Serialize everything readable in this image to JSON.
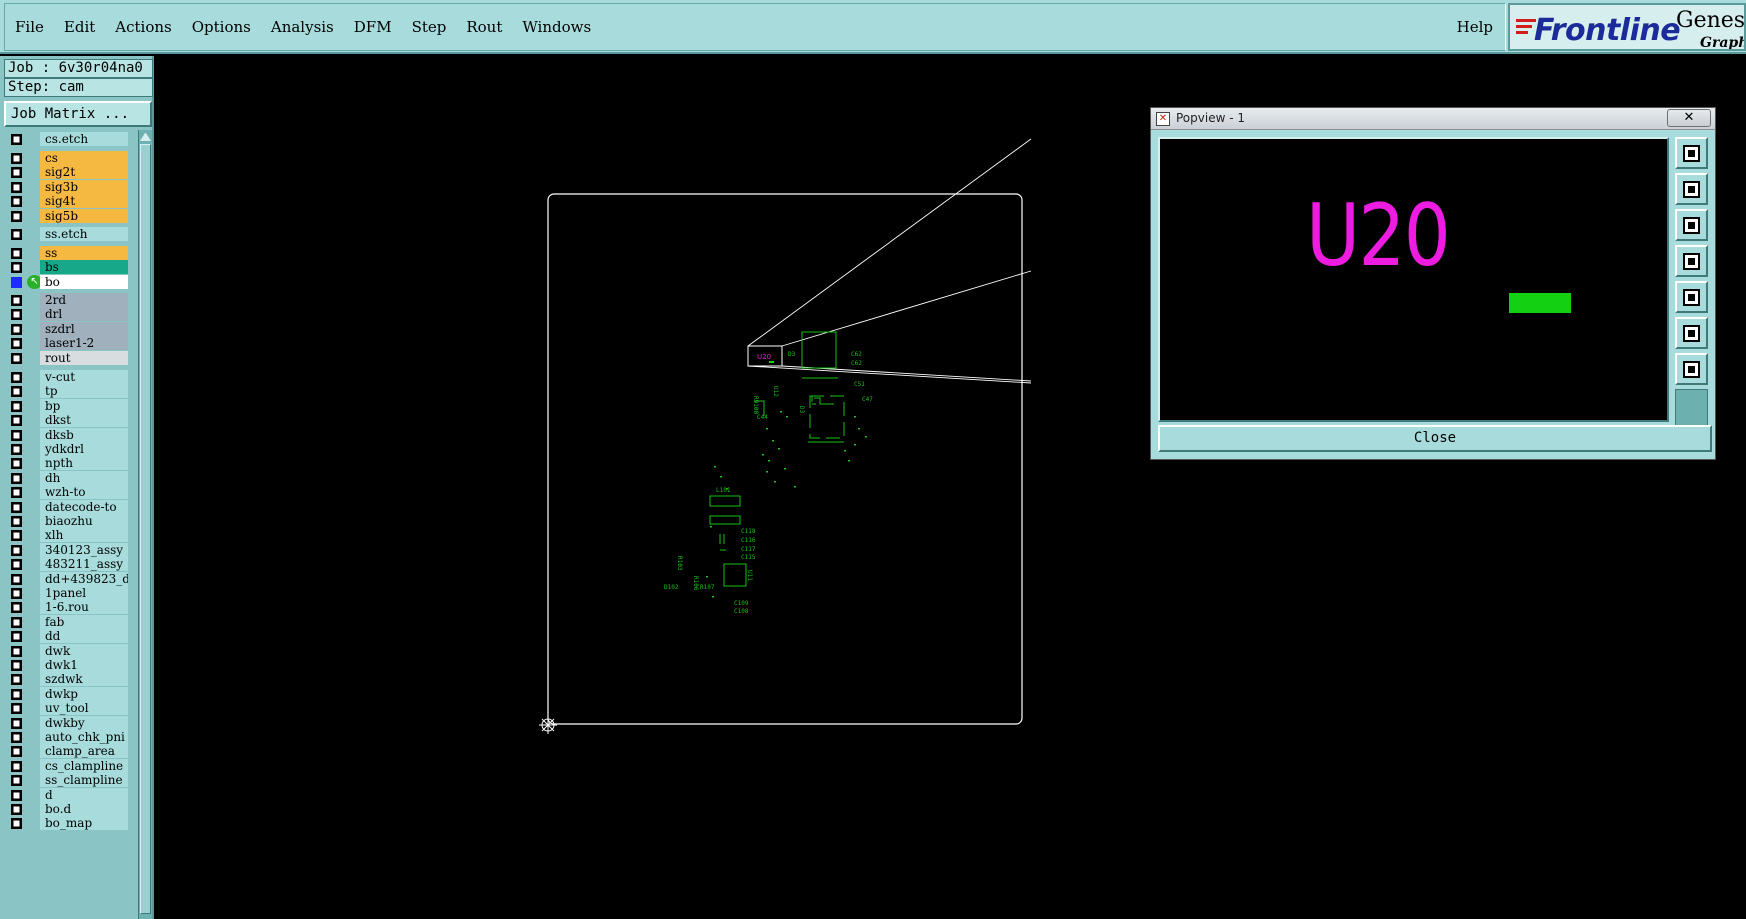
{
  "menu": {
    "items": [
      "File",
      "Edit",
      "Actions",
      "Options",
      "Analysis",
      "DFM",
      "Step",
      "Rout",
      "Windows"
    ],
    "help": "Help"
  },
  "brand": {
    "frontline": "Frontline",
    "genesis": "Genesis",
    "graphic": "Graphic"
  },
  "job": {
    "job_label": "Job : 6v30r04na0",
    "step_label": "Step: cam",
    "matrix_button": "Job Matrix ..."
  },
  "layers": [
    {
      "name": "cs.etch",
      "color": "#a8dcdc",
      "group": 1
    },
    {
      "name": "cs",
      "color": "#f5b942",
      "group": 2
    },
    {
      "name": "sig2t",
      "color": "#f5b942",
      "group": 2
    },
    {
      "name": "sig3b",
      "color": "#f5b942",
      "group": 2
    },
    {
      "name": "sig4t",
      "color": "#f5b942",
      "group": 2
    },
    {
      "name": "sig5b",
      "color": "#f5b942",
      "group": 2
    },
    {
      "name": "ss.etch",
      "color": "#a8dcdc",
      "group": 3
    },
    {
      "name": "ss",
      "color": "#f5b942",
      "group": 4
    },
    {
      "name": "bs",
      "color": "#17a88a",
      "group": 4
    },
    {
      "name": "bo",
      "color": "#ffffff",
      "group": 4,
      "active": true
    },
    {
      "name": "2rd",
      "color": "#a0b0bc",
      "group": 5
    },
    {
      "name": "drl",
      "color": "#a0b0bc",
      "group": 5
    },
    {
      "name": "szdrl",
      "color": "#a0b0bc",
      "group": 5
    },
    {
      "name": "laser1-2",
      "color": "#a0b0bc",
      "group": 5
    },
    {
      "name": "rout",
      "color": "#d8dde0",
      "group": 5
    },
    {
      "name": "v-cut",
      "color": "#a8dcdc",
      "group": 6
    },
    {
      "name": "tp",
      "color": "#a8dcdc",
      "group": 6
    },
    {
      "name": "bp",
      "color": "#a8dcdc",
      "group": 6
    },
    {
      "name": "dkst",
      "color": "#a8dcdc",
      "group": 6
    },
    {
      "name": "dksb",
      "color": "#a8dcdc",
      "group": 6
    },
    {
      "name": "ydkdrl",
      "color": "#a8dcdc",
      "group": 6
    },
    {
      "name": "npth",
      "color": "#a8dcdc",
      "group": 6
    },
    {
      "name": "dh",
      "color": "#a8dcdc",
      "group": 6
    },
    {
      "name": "wzh-to",
      "color": "#a8dcdc",
      "group": 6
    },
    {
      "name": "datecode-to",
      "color": "#a8dcdc",
      "group": 6
    },
    {
      "name": "biaozhu",
      "color": "#a8dcdc",
      "group": 6
    },
    {
      "name": "xlh",
      "color": "#a8dcdc",
      "group": 6
    },
    {
      "name": "340123_assy",
      "color": "#a8dcdc",
      "group": 6
    },
    {
      "name": "483211_assy",
      "color": "#a8dcdc",
      "group": 6
    },
    {
      "name": "dd+439823_d",
      "color": "#a8dcdc",
      "group": 6
    },
    {
      "name": "1panel",
      "color": "#a8dcdc",
      "group": 6
    },
    {
      "name": "1-6.rou",
      "color": "#a8dcdc",
      "group": 6
    },
    {
      "name": "fab",
      "color": "#a8dcdc",
      "group": 6
    },
    {
      "name": "dd",
      "color": "#a8dcdc",
      "group": 6
    },
    {
      "name": "dwk",
      "color": "#a8dcdc",
      "group": 6
    },
    {
      "name": "dwk1",
      "color": "#a8dcdc",
      "group": 6
    },
    {
      "name": "szdwk",
      "color": "#a8dcdc",
      "group": 6
    },
    {
      "name": "dwkp",
      "color": "#a8dcdc",
      "group": 6
    },
    {
      "name": "uv_tool",
      "color": "#a8dcdc",
      "group": 6
    },
    {
      "name": "dwkby",
      "color": "#a8dcdc",
      "group": 6
    },
    {
      "name": "auto_chk_pni",
      "color": "#a8dcdc",
      "group": 6
    },
    {
      "name": "clamp_area",
      "color": "#a8dcdc",
      "group": 6
    },
    {
      "name": "cs_clampline",
      "color": "#a8dcdc",
      "group": 6
    },
    {
      "name": "ss_clampline",
      "color": "#a8dcdc",
      "group": 6
    },
    {
      "name": "d",
      "color": "#a8dcdc",
      "group": 6
    },
    {
      "name": "bo.d",
      "color": "#a8dcdc",
      "group": 6
    },
    {
      "name": "bo_map",
      "color": "#a8dcdc",
      "group": 6
    }
  ],
  "canvas": {
    "component_labels": [
      "U20",
      "D3",
      "C62",
      "C62",
      "U12",
      "R9100",
      "C44",
      "D3",
      "C51",
      "C47",
      "L101",
      "C118",
      "C116",
      "C117",
      "C115",
      "U11",
      "C109",
      "C108",
      "R103",
      "D102",
      "R106",
      "R107"
    ]
  },
  "popview": {
    "title": "Popview - 1",
    "close_x": "✕",
    "refdes": "U20",
    "close_button": "Close",
    "pad_color": "#13d013",
    "text_color": "#ee1be0"
  },
  "colors": {
    "menubar": "#a8dcdc",
    "panel": "#8ac4c4",
    "canvas_bg": "#000000",
    "board_outline": "#ffffff",
    "silkscreen": "#19c119"
  }
}
